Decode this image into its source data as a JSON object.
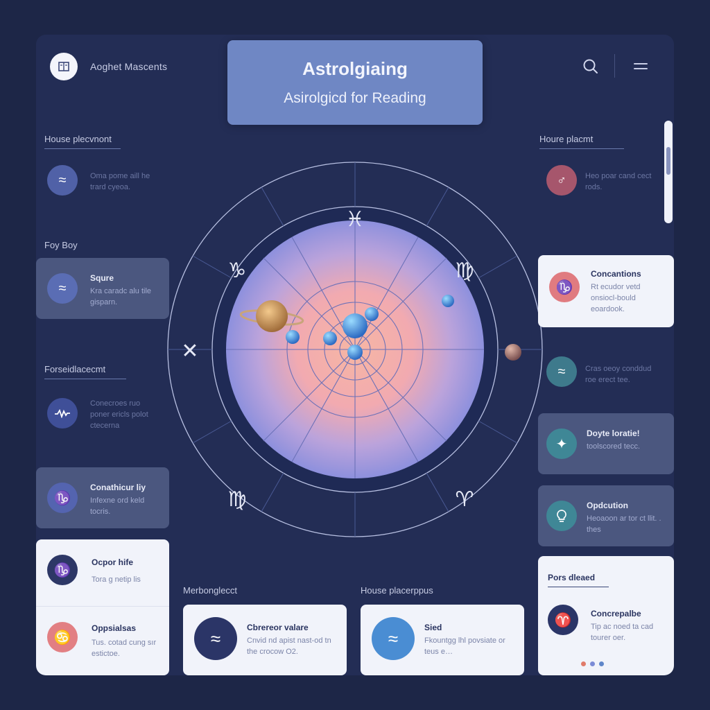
{
  "app": {
    "name": "Aoghet Mascents",
    "logo_icon": "book-icon"
  },
  "hero": {
    "title": "Astrolgiaing",
    "subtitle": "Asirolgicd for Reading"
  },
  "header": {
    "search_icon": "search-icon",
    "menu_icon": "menu-icon"
  },
  "left": {
    "section1": "House plecvnont",
    "row1": {
      "icon": "aquarius-icon",
      "text": "Oma pome aill he trard cyeoa."
    },
    "section2": "Foy Boy",
    "card1": {
      "icon": "aquarius-icon",
      "title": "Squre",
      "body": "Kra caradc alu tile gisparn."
    },
    "section3": "Forseidlacecmt",
    "row2": {
      "icon": "wave-icon",
      "text": "Conecroes ruo poner ericls polot ctecerna"
    },
    "card2": {
      "icon": "capricorn-icon",
      "title": "Conathicur liy",
      "body": "Infexne ord keld tocris."
    },
    "card3": {
      "icon": "capricorn-icon",
      "title": "Ocpor hife",
      "body": "Tora g netip lis"
    },
    "card4": {
      "icon": "cancer-icon",
      "title": "Oppsialsas",
      "body": "Tus. cotad cung sır estictoe."
    }
  },
  "right": {
    "section1": "Houre placmt",
    "row1": {
      "icon": "mars-icon",
      "text": "Heo poar cand cect rods."
    },
    "card1": {
      "icon": "capricorn-icon",
      "title": "Concantions",
      "body": "Rt ecudor vetd onsiocl-bould eoardook."
    },
    "row2": {
      "icon": "aquarius-icon",
      "text": "Cras oeoy conddud roe erect tee."
    },
    "card2": {
      "icon": "star-icon",
      "title": "Doyte loratie!",
      "body": "toolscored tecc."
    },
    "card3": {
      "icon": "bulb-icon",
      "title": "Opdcution",
      "body": "Heoaoon ar tor ct llit. . thes"
    },
    "section2": "Pors dleaed",
    "card4": {
      "icon": "aries-icon",
      "title": "Concrepalbe",
      "body": "Tip ac noed ta cad tourer oer."
    },
    "dots_colors": [
      "#e07b6a",
      "#7b8bd6",
      "#5f86c9"
    ]
  },
  "bottom": {
    "section1": "Merbonglecct",
    "card1": {
      "icon": "aquarius-icon",
      "title": "Cbrereor valare",
      "body": "Cnvid nd apist nast-od tn the crocow O2."
    },
    "section2": "House placerppus",
    "card2": {
      "icon": "aquarius-icon",
      "title": "Sied",
      "body": "Fkountgg lhl povsiate or teus e…"
    }
  },
  "wheel": {
    "signs": [
      {
        "glyph": "♓",
        "name": "pisces-icon"
      },
      {
        "glyph": "♍",
        "name": "virgo-icon"
      },
      {
        "glyph": "♑",
        "name": "capricorn-icon"
      },
      {
        "glyph": "♈",
        "name": "aries-icon"
      },
      {
        "glyph": "♍",
        "name": "virgo-icon"
      },
      {
        "glyph": "✕",
        "name": "cross-icon"
      },
      {
        "glyph": "♈",
        "name": "aries-icon"
      }
    ]
  },
  "colors": {
    "accent": "#6f87c4",
    "background": "#1d2647",
    "panel": "#232d55"
  }
}
